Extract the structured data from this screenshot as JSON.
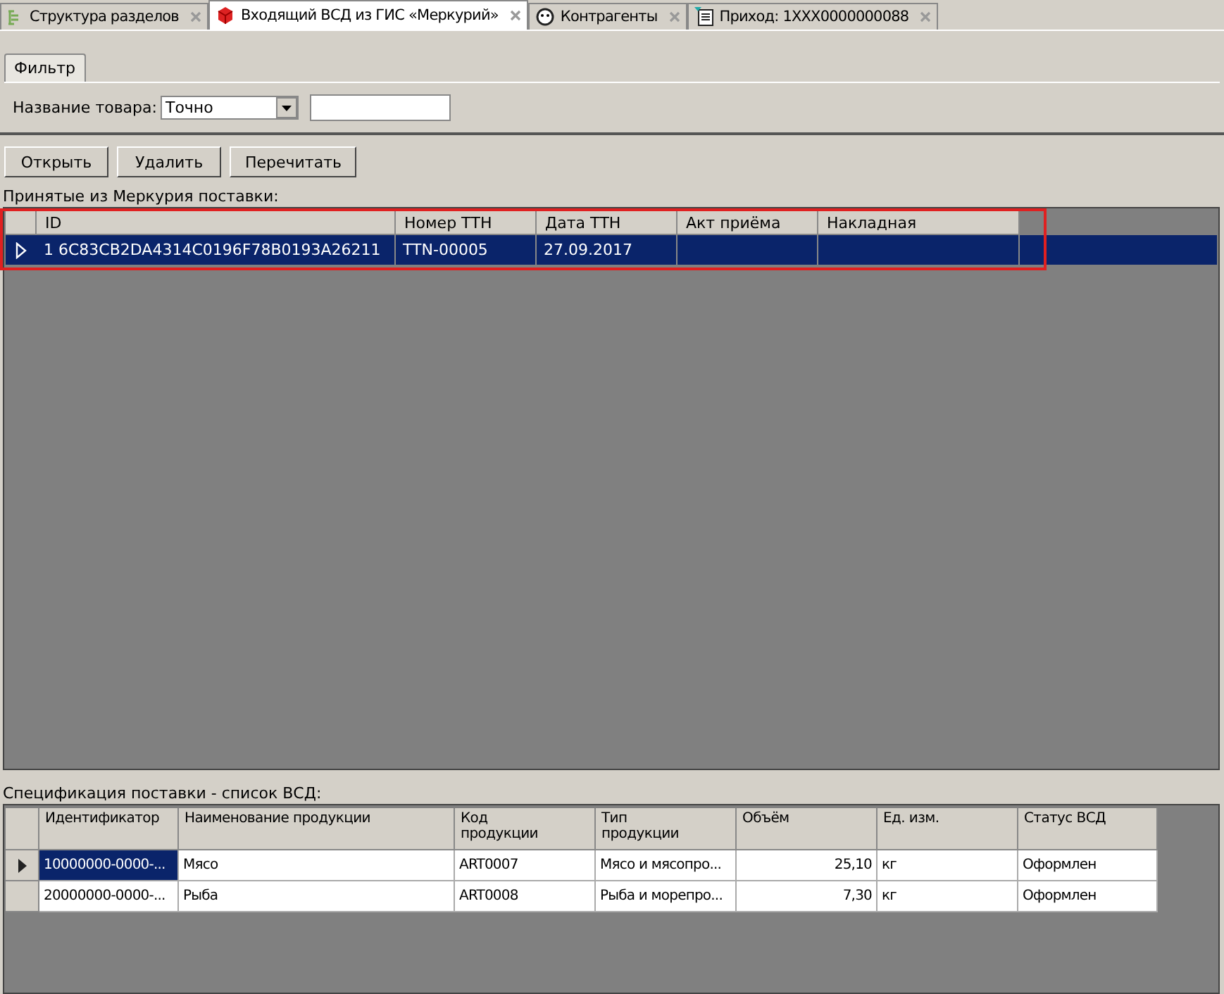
{
  "tabs": [
    {
      "label": "Структура разделов",
      "selected": false
    },
    {
      "label": "Входящий ВСД из ГИС «Меркурий»",
      "selected": true
    },
    {
      "label": "Контрагенты",
      "selected": false
    },
    {
      "label": "Приход: 1XXX0000000088",
      "selected": false
    }
  ],
  "filter": {
    "tab": "Фильтр",
    "label": "Название товара:",
    "mode": "Точно"
  },
  "buttons": [
    "Открыть",
    "Удалить",
    "Перечитать"
  ],
  "received": {
    "label": "Принятые из Меркурия поставки:",
    "highlighted": true,
    "columns": [
      "ID",
      "Номер ТТН",
      "Дата ТТН",
      "Акт приёма",
      "Накладная"
    ],
    "rows": [
      {
        "current": true,
        "selected": true,
        "cells": [
          "1  6C83CB2DA4314C0196F78B0193A26211",
          "TTN-00005",
          "27.09.2017",
          "",
          ""
        ]
      }
    ]
  },
  "spec": {
    "label": "Спецификация поставки - список ВСД:",
    "columns": [
      "Идентификатор",
      "Наименование продукции",
      "Код\nпродукции",
      "Тип\nпродукции",
      "Объём",
      "Ед. изм.",
      "Статус ВСД"
    ],
    "rows": [
      {
        "current": true,
        "selected": true,
        "cells": [
          "10000000-0000-...",
          "Мясо",
          "ART0007",
          "Мясо и мясопро...",
          "25,10",
          "кг",
          "Оформлен"
        ]
      },
      {
        "current": false,
        "selected": false,
        "cells": [
          "20000000-0000-...",
          "Рыба",
          "ART0008",
          "Рыба и морепро...",
          "7,30",
          "кг",
          "Оформлен"
        ]
      }
    ]
  }
}
